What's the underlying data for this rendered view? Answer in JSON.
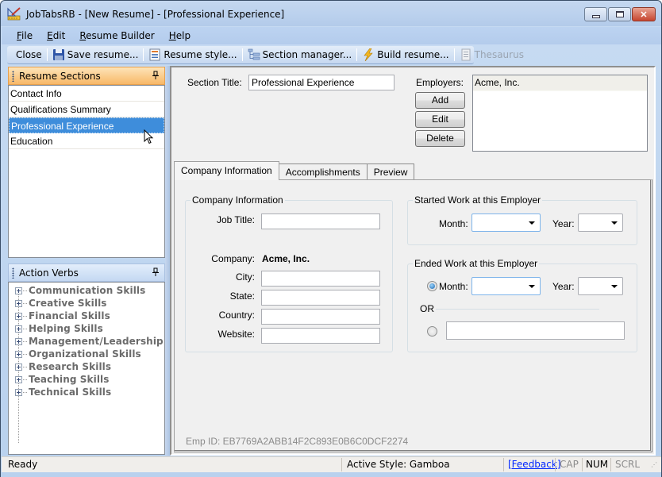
{
  "window": {
    "title": "JobTabsRB - [New Resume] - [Professional Experience]",
    "minimize_label": "minimize",
    "maximize_label": "maximize",
    "close_label": "close"
  },
  "menu": [
    {
      "label": "File",
      "accel": "F",
      "rest": "ile"
    },
    {
      "label": "Edit",
      "accel": "E",
      "rest": "dit"
    },
    {
      "label": "Resume Builder",
      "accel": "R",
      "rest": "esume Builder"
    },
    {
      "label": "Help",
      "accel": "H",
      "rest": "elp"
    }
  ],
  "toolbar": {
    "close": "Close",
    "save": "Save resume...",
    "style": "Resume style...",
    "section_manager": "Section manager...",
    "build": "Build resume...",
    "thesaurus": "Thesaurus"
  },
  "resume_sections": {
    "title": "Resume Sections",
    "items": [
      "Contact Info",
      "Qualifications Summary",
      "Professional Experience",
      "Education"
    ],
    "selected_index": 2
  },
  "action_verbs": {
    "title": "Action Verbs",
    "items": [
      "Communication Skills",
      "Creative Skills",
      "Financial Skills",
      "Helping Skills",
      "Management/Leadership",
      "Organizational Skills",
      "Research Skills",
      "Teaching Skills",
      "Technical Skills"
    ]
  },
  "main": {
    "section_title_label": "Section Title:",
    "section_title_value": "Professional Experience",
    "employers_label": "Employers:",
    "add_button": "Add",
    "edit_button": "Edit",
    "delete_button": "Delete",
    "employers": [
      "Acme, Inc."
    ],
    "tabs": [
      {
        "label": "Company Information",
        "active": true
      },
      {
        "label": "Accomplishments",
        "active": false
      },
      {
        "label": "Preview",
        "active": false
      }
    ],
    "company_info": {
      "group_title": "Company Information",
      "job_title_label": "Job Title:",
      "job_title_value": "",
      "company_label": "Company:",
      "company_value": "Acme, Inc.",
      "city_label": "City:",
      "city_value": "",
      "state_label": "State:",
      "state_value": "",
      "country_label": "Country:",
      "country_value": "",
      "website_label": "Website:",
      "website_value": ""
    },
    "started": {
      "group_title": "Started Work at this Employer",
      "month_label": "Month:",
      "month_value": "",
      "year_label": "Year:",
      "year_value": ""
    },
    "ended": {
      "group_title": "Ended Work at this Employer",
      "month_label": "Month:",
      "month_value": "",
      "year_label": "Year:",
      "year_value": "",
      "or_label": "OR",
      "other_value": "",
      "month_radio_checked": true
    },
    "emp_id": "Emp ID: EB7769A2ABB14F2C893E0B6C0DCF2274"
  },
  "statusbar": {
    "status": "Ready",
    "active_style": "Active Style: Gamboa",
    "feedback": "[Feedback]",
    "cap": "CAP",
    "num": "NUM",
    "scrl": "SCRL"
  }
}
